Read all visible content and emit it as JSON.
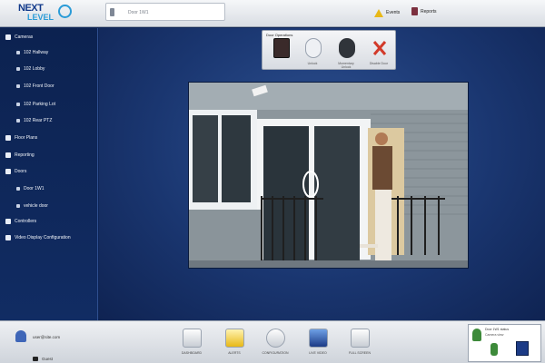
{
  "app": {
    "logo_line1": "NEXT",
    "logo_line2": "LEVEL"
  },
  "search": {
    "placeholder": "Door 1W1"
  },
  "toolbar": {
    "alerts_label": "Events",
    "reports_label": "Reports"
  },
  "sidebar": {
    "items": [
      {
        "label": "Cameras",
        "icon": "camera-icon",
        "indent": 0
      },
      {
        "label": "102 Hallway",
        "icon": "bullet-icon",
        "indent": 1
      },
      {
        "label": "102 Lobby",
        "icon": "bullet-icon",
        "indent": 1
      },
      {
        "label": "102 Front Door",
        "icon": "bullet-icon",
        "indent": 1
      },
      {
        "label": "102 Parking Lot",
        "icon": "bullet-icon",
        "indent": 1
      },
      {
        "label": "102 Rear PTZ",
        "icon": "bullet-icon",
        "indent": 1
      },
      {
        "label": "Floor Plans",
        "icon": "floorplan-icon",
        "indent": 0
      },
      {
        "label": "Reporting",
        "icon": "report-icon",
        "indent": 0
      },
      {
        "label": "Doors",
        "icon": "door-icon",
        "indent": 0
      },
      {
        "label": "Door 1W1",
        "icon": "bullet-icon",
        "indent": 1
      },
      {
        "label": "vehicle door",
        "icon": "bullet-icon",
        "indent": 1
      },
      {
        "label": "Controllers",
        "icon": "controller-icon",
        "indent": 0
      },
      {
        "label": "Video Display Configuration",
        "icon": "display-icon",
        "indent": 0
      }
    ]
  },
  "door_panel": {
    "title": "Door Operations",
    "buttons": [
      {
        "label": "",
        "icon": "door-reader-icon"
      },
      {
        "label": "Unlock",
        "icon": "unlock-icon"
      },
      {
        "label": "Momentary Unlock",
        "icon": "momentary-unlock-icon"
      },
      {
        "label": "Disable Door",
        "icon": "disable-icon"
      }
    ]
  },
  "bottom": {
    "user_email": "user@site.com",
    "user_name": "Guest",
    "buttons": [
      {
        "label": "DASHBOARD",
        "icon": "dashboard-icon"
      },
      {
        "label": "ALERTS",
        "icon": "alert-icon"
      },
      {
        "label": "CONFIGURATION",
        "icon": "configuration-icon"
      },
      {
        "label": "LIVE VIDEO",
        "icon": "live-video-icon"
      },
      {
        "label": "FULL SCREEN",
        "icon": "fullscreen-icon"
      }
    ],
    "mini_title": "Door 1W1 status",
    "mini_line": "Camera view"
  },
  "colors": {
    "nav_bg": "#112c63",
    "main_bg": "#1a3670",
    "accent": "#2a9bd7",
    "warning": "#e8b817",
    "danger": "#d23a2a"
  }
}
